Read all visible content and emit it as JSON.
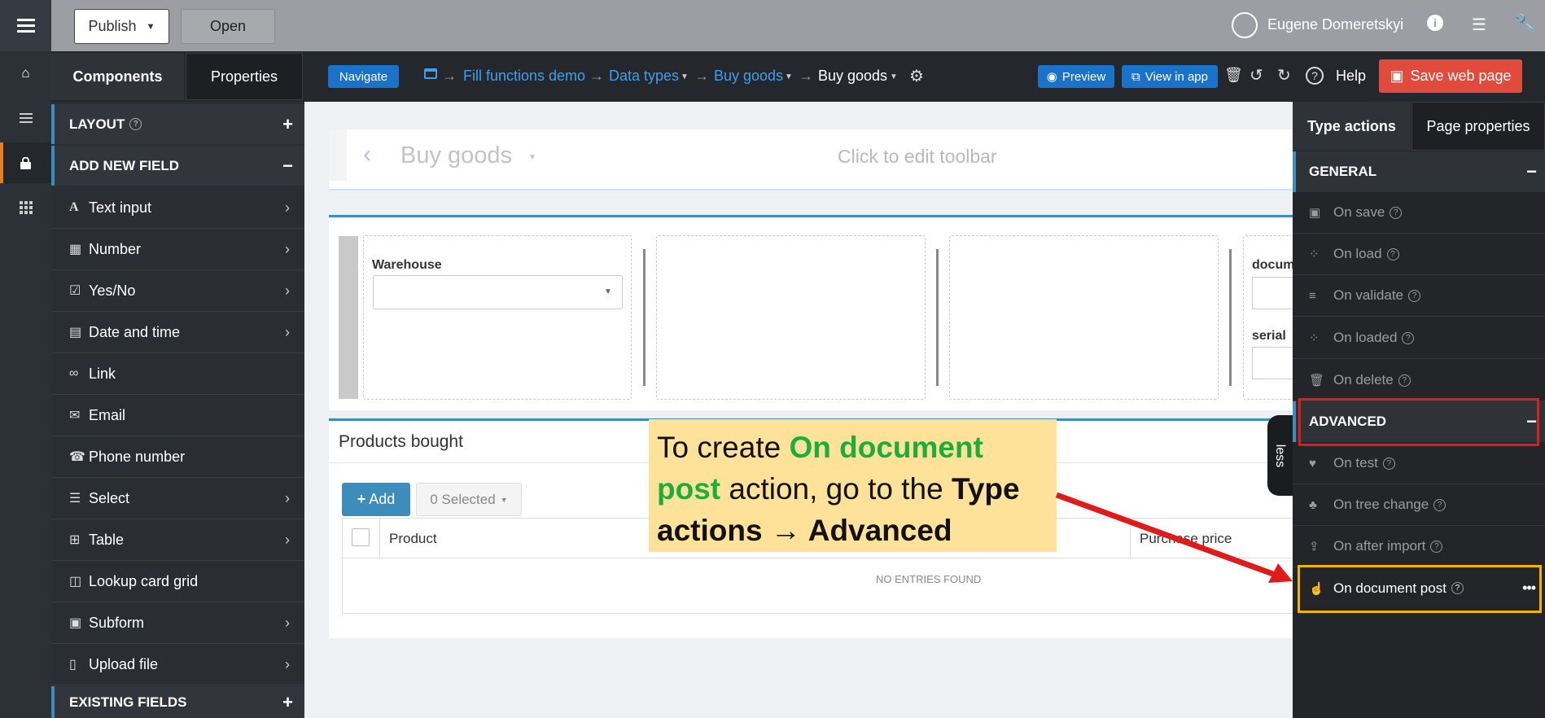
{
  "topbar": {
    "publish_label": "Publish",
    "open_label": "Open",
    "user_name": "Eugene Domeretskyi"
  },
  "left_tabs": {
    "components": "Components",
    "properties": "Properties"
  },
  "toolbar": {
    "navigate": "Navigate",
    "breadcrumbs": [
      "Fill functions demo",
      "Data types",
      "Buy goods",
      "Buy goods"
    ],
    "preview": "Preview",
    "view_in_app": "View in app",
    "help": "Help",
    "save": "Save web page"
  },
  "components_panel": {
    "layout_header": "LAYOUT",
    "add_new_header": "ADD NEW FIELD",
    "items": [
      {
        "label": "Text input",
        "icon": "text-icon"
      },
      {
        "label": "Number",
        "icon": "calculator-icon"
      },
      {
        "label": "Yes/No",
        "icon": "checkbox-icon"
      },
      {
        "label": "Date and time",
        "icon": "calendar-icon"
      },
      {
        "label": "Link",
        "icon": "link-icon"
      },
      {
        "label": "Email",
        "icon": "envelope-icon"
      },
      {
        "label": "Phone number",
        "icon": "phone-icon"
      },
      {
        "label": "Select",
        "icon": "list-icon"
      },
      {
        "label": "Table",
        "icon": "table-icon"
      },
      {
        "label": "Lookup card grid",
        "icon": "columns-icon"
      },
      {
        "label": "Subform",
        "icon": "subform-icon"
      },
      {
        "label": "Upload file",
        "icon": "file-icon"
      }
    ],
    "existing_header": "EXISTING FIELDS"
  },
  "canvas": {
    "toolbar_title": "Buy goods",
    "toolbar_hint": "Click to edit toolbar",
    "warehouse_label": "Warehouse",
    "document_label": "docum",
    "serial_label": "serial",
    "products_title": "Products bought",
    "add_label": "Add",
    "selected_label": "0 Selected",
    "col_product": "Product",
    "col_purchase_price": "Purchase price",
    "empty_text": "NO ENTRIES FOUND",
    "less_label": "less"
  },
  "right_panel": {
    "tab_type_actions": "Type actions",
    "tab_page_properties": "Page properties",
    "general_header": "GENERAL",
    "general_items": [
      "On save",
      "On load",
      "On validate",
      "On loaded",
      "On delete"
    ],
    "advanced_header": "ADVANCED",
    "advanced_items": [
      "On test",
      "On tree change",
      "On after import",
      "On document post"
    ]
  },
  "callout": {
    "part1": "To create ",
    "highlight": "On document post",
    "part2": " action, go to the ",
    "bold": "Type actions → Advanced"
  },
  "colors": {
    "accent": "#3c8dbc",
    "save": "#e24a3b",
    "callout_bg": "#ffe29a",
    "highlight_green": "#1bae3a",
    "red_box": "#e01b1b",
    "yellow_box": "#f0b400"
  }
}
